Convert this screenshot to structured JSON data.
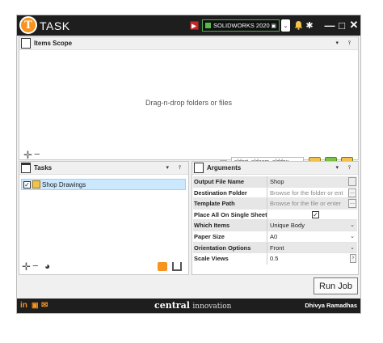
{
  "app": {
    "title": "TASK",
    "logo_letter": "T"
  },
  "titlebar": {
    "version_select": "SOLIDWORKS 2020",
    "icons": [
      "sw-exit-icon",
      "bell-icon",
      "gear-icon"
    ],
    "window_controls": {
      "minimize": "—",
      "maximize": "□",
      "close": "✕"
    }
  },
  "items_scope": {
    "title": "Items Scope",
    "drop_hint": "Drag-n-drop folders or files",
    "filter_value": "sldprt, sldasm, slddrw"
  },
  "tasks": {
    "title": "Tasks",
    "items": [
      {
        "label": "Shop Drawings",
        "checked": true
      }
    ]
  },
  "arguments": {
    "title": "Arguments",
    "rows": [
      {
        "name": "Output File Name",
        "value": "Shop",
        "placeholder": false
      },
      {
        "name": "Destination Folder",
        "value": "Browse for the folder or ent",
        "placeholder": true
      },
      {
        "name": "Template Path",
        "value": "Browse for the file or enter",
        "placeholder": true
      },
      {
        "name": "Place All On Single Sheet",
        "value": "✓",
        "placeholder": false
      },
      {
        "name": "Which Items",
        "value": "Unique Body",
        "placeholder": false
      },
      {
        "name": "Paper Size",
        "value": "A0",
        "placeholder": false
      },
      {
        "name": "Orientation Options",
        "value": "Front",
        "placeholder": false
      },
      {
        "name": "Scale Views",
        "value": "0.5",
        "placeholder": false
      }
    ]
  },
  "run_button": "Run Job",
  "footer": {
    "brand_main": "central",
    "brand_sub": "innovation",
    "user": "Dhivya Ramadhas",
    "social": [
      "in",
      "yt",
      "mail"
    ]
  }
}
